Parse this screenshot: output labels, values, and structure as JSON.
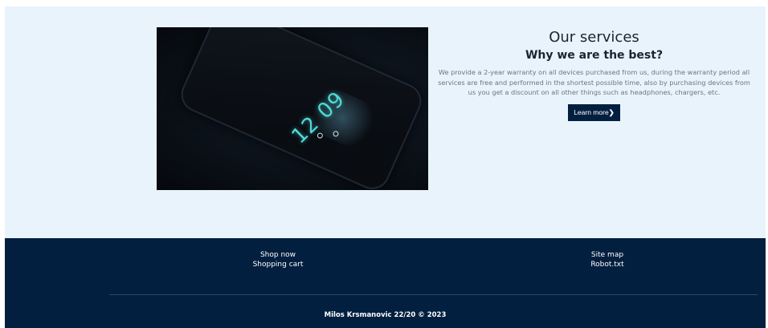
{
  "services": {
    "title": "Our services",
    "subtitle": "Why we are the best?",
    "description": "We provide a 2-year warranty on all devices purchased from us, during the warranty period all services are free and performed in the shortest possible time, also by purchasing devices from us you get a discount on all other things such as headphones, chargers, etc.",
    "button_label": "Learn more",
    "button_icon": "chevron-right-icon",
    "image_alt": "Smartphone lock screen on a dark surface",
    "phone_time": "12 09"
  },
  "footer": {
    "left_links": [
      "Shop now",
      "Shopping cart"
    ],
    "right_links": [
      "Site map",
      "Robot.txt"
    ],
    "copyright": "Milos Krsmanovic 22/20 © 2023"
  },
  "colors": {
    "section_background": "#e9f3fc",
    "navy": "#021f3f",
    "description_text": "#6c7682"
  }
}
